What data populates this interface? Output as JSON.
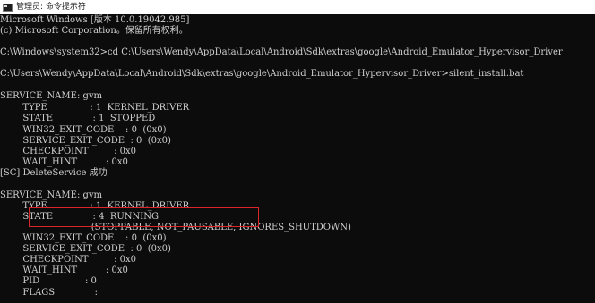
{
  "window": {
    "title": "管理员: 命令提示符"
  },
  "console": {
    "lines": [
      "Microsoft Windows [版本 10.0.19042.985]",
      "(c) Microsoft Corporation。保留所有权利。",
      "",
      "C:\\Windows\\system32>cd C:\\Users\\Wendy\\AppData\\Local\\Android\\Sdk\\extras\\google\\Android_Emulator_Hypervisor_Driver",
      "",
      "C:\\Users\\Wendy\\AppData\\Local\\Android\\Sdk\\extras\\google\\Android_Emulator_Hypervisor_Driver>silent_install.bat",
      "",
      "SERVICE_NAME: gvm",
      "        TYPE               : 1  KERNEL_DRIVER",
      "        STATE              : 1  STOPPED",
      "        WIN32_EXIT_CODE    : 0  (0x0)",
      "        SERVICE_EXIT_CODE  : 0  (0x0)",
      "        CHECKPOINT         : 0x0",
      "        WAIT_HINT          : 0x0",
      "[SC] DeleteService 成功",
      "",
      "SERVICE_NAME: gvm",
      "        TYPE               : 1  KERNEL_DRIVER",
      "        STATE              : 4  RUNNING",
      "                                (STOPPABLE, NOT_PAUSABLE, IGNORES_SHUTDOWN)",
      "        WIN32_EXIT_CODE    : 0  (0x0)",
      "        SERVICE_EXIT_CODE  : 0  (0x0)",
      "        CHECKPOINT         : 0x0",
      "        WAIT_HINT          : 0x0",
      "        PID                : 0",
      "        FLAGS              :"
    ]
  },
  "annotation": {
    "highlight_color": "#d9262a"
  },
  "colors": {
    "background": "#0c0c0c",
    "text": "#d0d0d0",
    "titlebar": "#ffffff"
  }
}
